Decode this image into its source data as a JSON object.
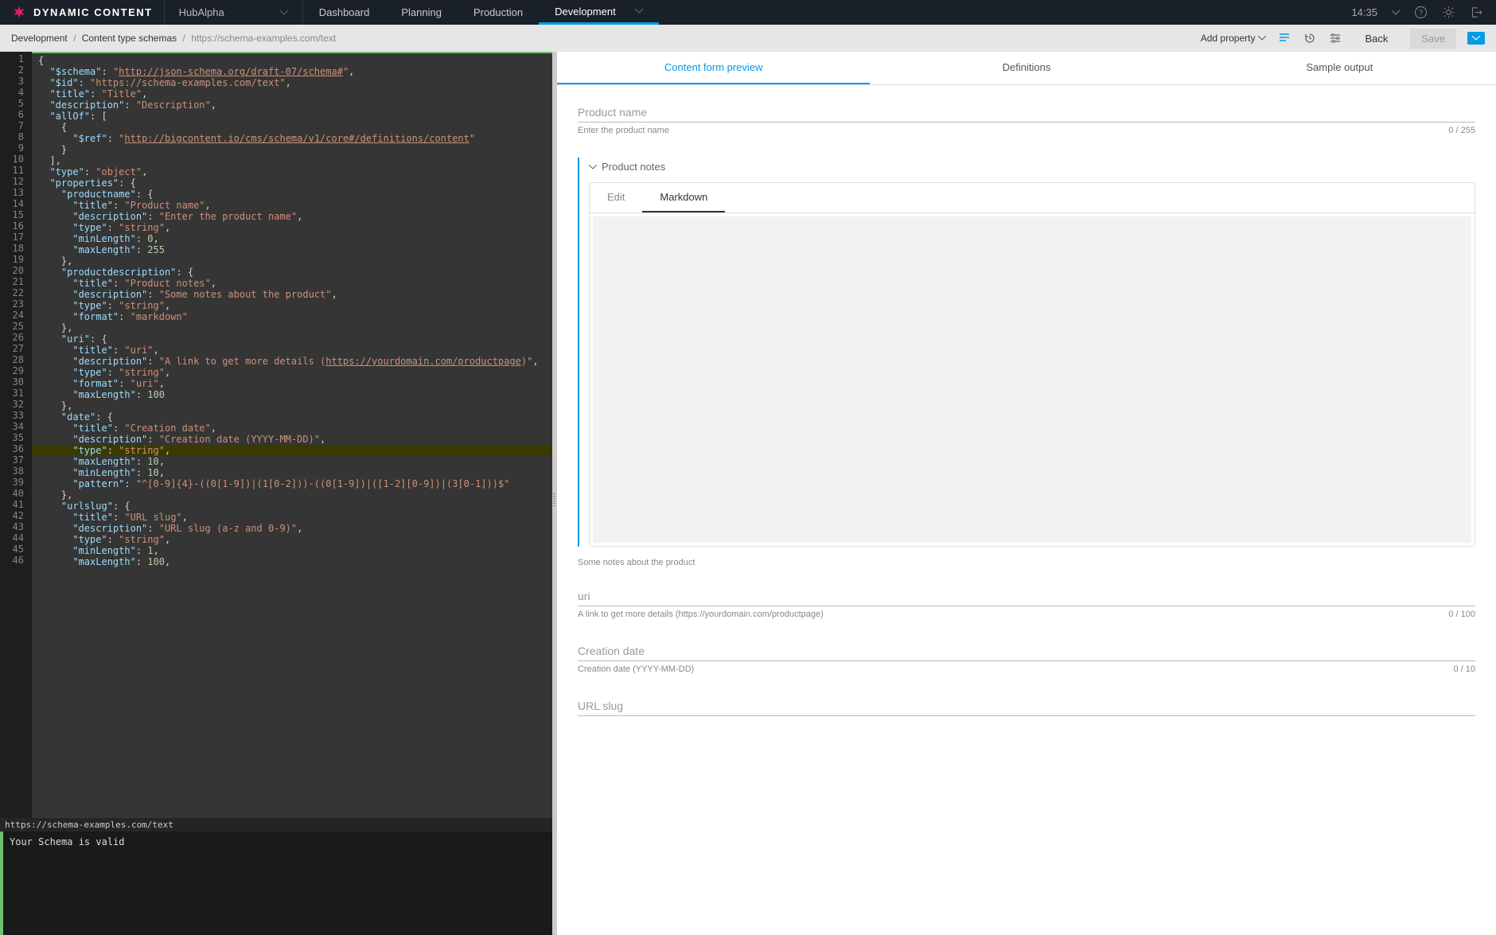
{
  "header": {
    "logo_text": "DYNAMIC CONTENT",
    "hub_label": "HubAlpha",
    "tabs": [
      "Dashboard",
      "Planning",
      "Production",
      "Development"
    ],
    "active_tab": "Development",
    "time": "14:35"
  },
  "subbar": {
    "breadcrumb": {
      "part1": "Development",
      "part2": "Content type schemas",
      "part3": "https://schema-examples.com/text"
    },
    "add_property": "Add property",
    "back": "Back",
    "save": "Save"
  },
  "editor": {
    "status_url": "https://schema-examples.com/text",
    "console_msg": "Your Schema is valid",
    "lines": [
      [
        [
          "{",
          "punc"
        ]
      ],
      [
        [
          "  ",
          ""
        ],
        [
          "\"$schema\"",
          "prop"
        ],
        [
          ": ",
          "punc"
        ],
        [
          "\"",
          "str"
        ],
        [
          "http://json-schema.org/draft-07/schema#",
          "link"
        ],
        [
          "\"",
          "str"
        ],
        [
          ",",
          "punc"
        ]
      ],
      [
        [
          "  ",
          ""
        ],
        [
          "\"$id\"",
          "prop"
        ],
        [
          ": ",
          "punc"
        ],
        [
          "\"https://schema-examples.com/text\"",
          "str"
        ],
        [
          ",",
          "punc"
        ]
      ],
      [
        [
          "  ",
          ""
        ],
        [
          "\"title\"",
          "prop"
        ],
        [
          ": ",
          "punc"
        ],
        [
          "\"Title\"",
          "str"
        ],
        [
          ",",
          "punc"
        ]
      ],
      [
        [
          "  ",
          ""
        ],
        [
          "\"description\"",
          "prop"
        ],
        [
          ": ",
          "punc"
        ],
        [
          "\"Description\"",
          "str"
        ],
        [
          ",",
          "punc"
        ]
      ],
      [
        [
          "  ",
          ""
        ],
        [
          "\"allOf\"",
          "prop"
        ],
        [
          ": [",
          "punc"
        ]
      ],
      [
        [
          "    {",
          "punc"
        ]
      ],
      [
        [
          "      ",
          ""
        ],
        [
          "\"$ref\"",
          "prop"
        ],
        [
          ": ",
          "punc"
        ],
        [
          "\"",
          "str"
        ],
        [
          "http://bigcontent.io/cms/schema/v1/core#/definitions/content",
          "link"
        ],
        [
          "\"",
          "str"
        ]
      ],
      [
        [
          "    }",
          "punc"
        ]
      ],
      [
        [
          "  ],",
          "punc"
        ]
      ],
      [
        [
          "  ",
          ""
        ],
        [
          "\"type\"",
          "prop"
        ],
        [
          ": ",
          "punc"
        ],
        [
          "\"object\"",
          "str"
        ],
        [
          ",",
          "punc"
        ]
      ],
      [
        [
          "  ",
          ""
        ],
        [
          "\"properties\"",
          "prop"
        ],
        [
          ": {",
          "punc"
        ]
      ],
      [
        [
          "    ",
          ""
        ],
        [
          "\"productname\"",
          "prop"
        ],
        [
          ": {",
          "punc"
        ]
      ],
      [
        [
          "      ",
          ""
        ],
        [
          "\"title\"",
          "prop"
        ],
        [
          ": ",
          "punc"
        ],
        [
          "\"Product name\"",
          "str"
        ],
        [
          ",",
          "punc"
        ]
      ],
      [
        [
          "      ",
          ""
        ],
        [
          "\"description\"",
          "prop"
        ],
        [
          ": ",
          "punc"
        ],
        [
          "\"Enter the product name\"",
          "str"
        ],
        [
          ",",
          "punc"
        ]
      ],
      [
        [
          "      ",
          ""
        ],
        [
          "\"type\"",
          "prop"
        ],
        [
          ": ",
          "punc"
        ],
        [
          "\"string\"",
          "str"
        ],
        [
          ",",
          "punc"
        ]
      ],
      [
        [
          "      ",
          ""
        ],
        [
          "\"minLength\"",
          "prop"
        ],
        [
          ": ",
          "punc"
        ],
        [
          "0",
          "num"
        ],
        [
          ",",
          "punc"
        ]
      ],
      [
        [
          "      ",
          ""
        ],
        [
          "\"maxLength\"",
          "prop"
        ],
        [
          ": ",
          "punc"
        ],
        [
          "255",
          "num"
        ]
      ],
      [
        [
          "    },",
          "punc"
        ]
      ],
      [
        [
          "    ",
          ""
        ],
        [
          "\"productdescription\"",
          "prop"
        ],
        [
          ": {",
          "punc"
        ]
      ],
      [
        [
          "      ",
          ""
        ],
        [
          "\"title\"",
          "prop"
        ],
        [
          ": ",
          "punc"
        ],
        [
          "\"Product notes\"",
          "str"
        ],
        [
          ",",
          "punc"
        ]
      ],
      [
        [
          "      ",
          ""
        ],
        [
          "\"description\"",
          "prop"
        ],
        [
          ": ",
          "punc"
        ],
        [
          "\"Some notes about the product\"",
          "str"
        ],
        [
          ",",
          "punc"
        ]
      ],
      [
        [
          "      ",
          ""
        ],
        [
          "\"type\"",
          "prop"
        ],
        [
          ": ",
          "punc"
        ],
        [
          "\"string\"",
          "str"
        ],
        [
          ",",
          "punc"
        ]
      ],
      [
        [
          "      ",
          ""
        ],
        [
          "\"format\"",
          "prop"
        ],
        [
          ": ",
          "punc"
        ],
        [
          "\"markdown\"",
          "str"
        ]
      ],
      [
        [
          "    },",
          "punc"
        ]
      ],
      [
        [
          "    ",
          ""
        ],
        [
          "\"uri\"",
          "prop"
        ],
        [
          ": {",
          "punc"
        ]
      ],
      [
        [
          "      ",
          ""
        ],
        [
          "\"title\"",
          "prop"
        ],
        [
          ": ",
          "punc"
        ],
        [
          "\"uri\"",
          "str"
        ],
        [
          ",",
          "punc"
        ]
      ],
      [
        [
          "      ",
          ""
        ],
        [
          "\"description\"",
          "prop"
        ],
        [
          ": ",
          "punc"
        ],
        [
          "\"A link to get more details (",
          "str"
        ],
        [
          "https://yourdomain.com/productpage",
          "link"
        ],
        [
          ")\"",
          "str"
        ],
        [
          ",",
          "punc"
        ]
      ],
      [
        [
          "      ",
          ""
        ],
        [
          "\"type\"",
          "prop"
        ],
        [
          ": ",
          "punc"
        ],
        [
          "\"string\"",
          "str"
        ],
        [
          ",",
          "punc"
        ]
      ],
      [
        [
          "      ",
          ""
        ],
        [
          "\"format\"",
          "prop"
        ],
        [
          ": ",
          "punc"
        ],
        [
          "\"uri\"",
          "str"
        ],
        [
          ",",
          "punc"
        ]
      ],
      [
        [
          "      ",
          ""
        ],
        [
          "\"maxLength\"",
          "prop"
        ],
        [
          ": ",
          "punc"
        ],
        [
          "100",
          "num"
        ]
      ],
      [
        [
          "    },",
          "punc"
        ]
      ],
      [
        [
          "    ",
          ""
        ],
        [
          "\"date\"",
          "prop"
        ],
        [
          ": {",
          "punc"
        ]
      ],
      [
        [
          "      ",
          ""
        ],
        [
          "\"title\"",
          "prop"
        ],
        [
          ": ",
          "punc"
        ],
        [
          "\"Creation date\"",
          "str"
        ],
        [
          ",",
          "punc"
        ]
      ],
      [
        [
          "      ",
          ""
        ],
        [
          "\"description\"",
          "prop"
        ],
        [
          ": ",
          "punc"
        ],
        [
          "\"Creation date (YYYY-MM-DD)\"",
          "str"
        ],
        [
          ",",
          "punc"
        ]
      ],
      [
        [
          "      ",
          ""
        ],
        [
          "\"type\"",
          "prop"
        ],
        [
          ": ",
          "punc"
        ],
        [
          "\"string\"",
          "str"
        ],
        [
          ",",
          "punc"
        ]
      ],
      [
        [
          "      ",
          ""
        ],
        [
          "\"maxLength\"",
          "prop"
        ],
        [
          ": ",
          "punc"
        ],
        [
          "10",
          "num"
        ],
        [
          ",",
          "punc"
        ]
      ],
      [
        [
          "      ",
          ""
        ],
        [
          "\"minLength\"",
          "prop"
        ],
        [
          ": ",
          "punc"
        ],
        [
          "10",
          "num"
        ],
        [
          ",",
          "punc"
        ]
      ],
      [
        [
          "      ",
          ""
        ],
        [
          "\"pattern\"",
          "prop"
        ],
        [
          ": ",
          "punc"
        ],
        [
          "\"^[0-9]{4}-((0[1-9])|(1[0-2]))-((0[1-9])|([1-2][0-9])|(3[0-1]))$\"",
          "str"
        ]
      ],
      [
        [
          "    },",
          "punc"
        ]
      ],
      [
        [
          "    ",
          ""
        ],
        [
          "\"urlslug\"",
          "prop"
        ],
        [
          ": {",
          "punc"
        ]
      ],
      [
        [
          "      ",
          ""
        ],
        [
          "\"title\"",
          "prop"
        ],
        [
          ": ",
          "punc"
        ],
        [
          "\"URL slug\"",
          "str"
        ],
        [
          ",",
          "punc"
        ]
      ],
      [
        [
          "      ",
          ""
        ],
        [
          "\"description\"",
          "prop"
        ],
        [
          ": ",
          "punc"
        ],
        [
          "\"URL slug (a-z and 0-9)\"",
          "str"
        ],
        [
          ",",
          "punc"
        ]
      ],
      [
        [
          "      ",
          ""
        ],
        [
          "\"type\"",
          "prop"
        ],
        [
          ": ",
          "punc"
        ],
        [
          "\"string\"",
          "str"
        ],
        [
          ",",
          "punc"
        ]
      ],
      [
        [
          "      ",
          ""
        ],
        [
          "\"minLength\"",
          "prop"
        ],
        [
          ": ",
          "punc"
        ],
        [
          "1",
          "num"
        ],
        [
          ",",
          "punc"
        ]
      ],
      [
        [
          "      ",
          ""
        ],
        [
          "\"maxLength\"",
          "prop"
        ],
        [
          ": ",
          "punc"
        ],
        [
          "100",
          "num"
        ],
        [
          ",",
          "punc"
        ]
      ]
    ],
    "highlight_line": 36
  },
  "preview": {
    "tabs": [
      "Content form preview",
      "Definitions",
      "Sample output"
    ],
    "active_tab": "Content form preview",
    "fields": {
      "productname": {
        "placeholder": "Product name",
        "help": "Enter the product name",
        "counter": "0 / 255"
      },
      "productdescription": {
        "title": "Product notes",
        "tabs": [
          "Edit",
          "Markdown"
        ],
        "active_tab": "Markdown",
        "help": "Some notes about the product"
      },
      "uri": {
        "placeholder": "uri",
        "help": "A link to get more details (https://yourdomain.com/productpage)",
        "counter": "0 / 100"
      },
      "date": {
        "placeholder": "Creation date",
        "help": "Creation date (YYYY-MM-DD)",
        "counter": "0 / 10"
      },
      "urlslug": {
        "placeholder": "URL slug"
      }
    }
  }
}
